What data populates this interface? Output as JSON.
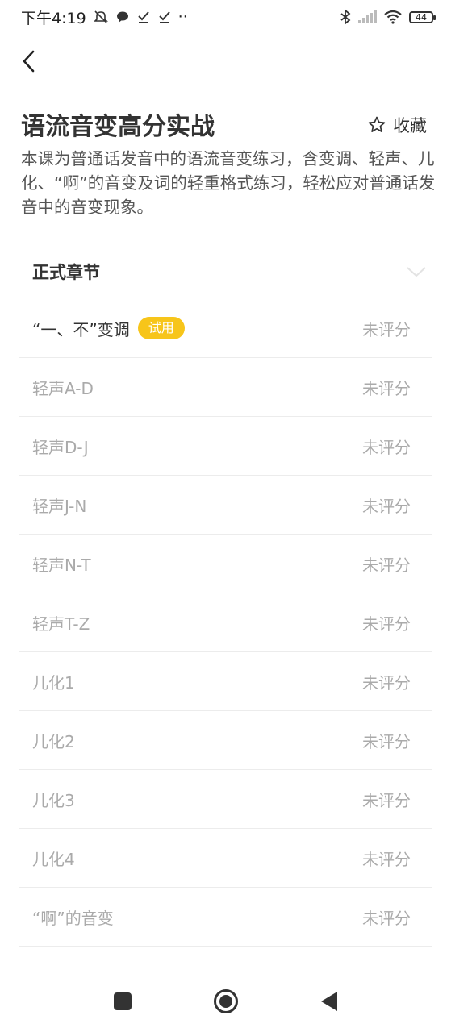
{
  "status_bar": {
    "time": "下午4:19",
    "dots": "··",
    "battery": "44"
  },
  "course": {
    "title": "语流音变高分实战",
    "favorite_label": "收藏",
    "description": "本课为普通话发音中的语流音变练习，含变调、轻声、儿化、“啊”的音变及词的轻重格式练习，轻松应对普通话发音中的音变现象。"
  },
  "section": {
    "title": "正式章节"
  },
  "chapters": [
    {
      "name": "“一、不”变调",
      "badge": "试用",
      "score": "未评分"
    },
    {
      "name": "轻声A-D",
      "score": "未评分"
    },
    {
      "name": "轻声D-J",
      "score": "未评分"
    },
    {
      "name": "轻声J-N",
      "score": "未评分"
    },
    {
      "name": "轻声N-T",
      "score": "未评分"
    },
    {
      "name": "轻声T-Z",
      "score": "未评分"
    },
    {
      "name": "儿化1",
      "score": "未评分"
    },
    {
      "name": "儿化2",
      "score": "未评分"
    },
    {
      "name": "儿化3",
      "score": "未评分"
    },
    {
      "name": "儿化4",
      "score": "未评分"
    },
    {
      "name": "“啊”的音变",
      "score": "未评分"
    }
  ],
  "colors": {
    "badge": "#f7c51a",
    "muted_text": "#aaaaaa",
    "primary_text": "#333333"
  },
  "icons": {
    "back": "chevron-left-icon",
    "favorite": "star-outline-icon",
    "collapse": "chevron-down-icon"
  }
}
